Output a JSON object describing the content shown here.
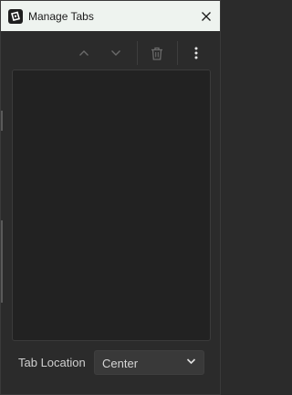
{
  "window": {
    "title": "Manage Tabs",
    "app_icon": "app-logo-icon",
    "close_icon": "close-icon"
  },
  "toolbar": {
    "buttons": [
      {
        "icon": "chevron-up-icon",
        "enabled": false
      },
      {
        "icon": "chevron-down-icon",
        "enabled": false
      },
      {
        "icon": "trash-icon",
        "enabled": false
      },
      {
        "icon": "more-vertical-icon",
        "enabled": true
      }
    ]
  },
  "tab_list": {
    "items": []
  },
  "footer": {
    "tab_location_label": "Tab Location",
    "tab_location_value": "Center",
    "chevron_icon": "chevron-down-icon"
  },
  "colors": {
    "background": "#2b2b2b",
    "titlebar": "#eef3ef",
    "list_background": "#222222",
    "disabled_icon": "#6a6a6a",
    "active_icon": "#e6e6e6"
  }
}
